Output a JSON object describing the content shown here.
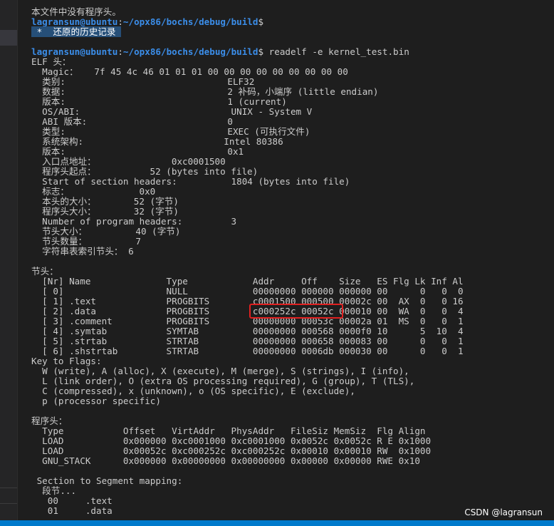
{
  "terminal": {
    "prior_output": "本文件中没有程序头。",
    "prompt1": {
      "user": "lagransun@ubuntu",
      "sep": ":",
      "path": "~/opx86/bochs/debug/build",
      "dollar": "$"
    },
    "history_marker": {
      "star": " * ",
      "text": " 还原的历史记录 "
    },
    "prompt2": {
      "user": "lagransun@ubuntu",
      "sep": ":",
      "path": "~/opx86/bochs/debug/build",
      "dollar": "$",
      "command": " readelf -e kernel_test.bin"
    },
    "elf_header": [
      "ELF 头：",
      "  Magic：   7f 45 4c 46 01 01 01 00 00 00 00 00 00 00 00 00",
      "  类别:                              ELF32",
      "  数据:                              2 补码，小端序 (little endian)",
      "  版本:                              1 (current)",
      "  OS/ABI:                            UNIX - System V",
      "  ABI 版本:                          0",
      "  类型:                              EXEC (可执行文件)",
      "  系统架构:                          Intel 80386",
      "  版本:                              0x1",
      "  入口点地址：              0xc0001500",
      "  程序头起点：          52 (bytes into file)",
      "  Start of section headers:          1804 (bytes into file)",
      "  标志：             0x0",
      "  本头的大小：       52 (字节)",
      "  程序头大小：       32 (字节)",
      "  Number of program headers:         3",
      "  节头大小：         40 (字节)",
      "  节头数量：         7",
      "  字符串表索引节头： 6"
    ],
    "section_headers_title": "节头：",
    "section_rows": [
      "  [Nr] Name              Type            Addr     Off    Size   ES Flg Lk Inf Al",
      "  [ 0]                   NULL            00000000 000000 000000 00      0   0  0",
      "  [ 1] .text             PROGBITS        c0001500 000500 00002c 00  AX  0   0 16",
      "  [ 2] .data             PROGBITS        c000252c 00052c 000010 00  WA  0   0  4",
      "  [ 3] .comment          PROGBITS        00000000 00053c 00002a 01  MS  0   0  1",
      "  [ 4] .symtab           SYMTAB          00000000 000568 0000f0 10      5  10  4",
      "  [ 5] .strtab           STRTAB          00000000 000658 000083 00      0   0  1",
      "  [ 6] .shstrtab         STRTAB          00000000 0006db 000030 00      0   0  1"
    ],
    "key_to_flags": [
      "Key to Flags:",
      "  W (write), A (alloc), X (execute), M (merge), S (strings), I (info),",
      "  L (link order), O (extra OS processing required), G (group), T (TLS),",
      "  C (compressed), x (unknown), o (OS specific), E (exclude),",
      "  p (processor specific)"
    ],
    "program_headers_title": "程序头：",
    "program_rows": [
      "  Type           Offset   VirtAddr   PhysAddr   FileSiz MemSiz  Flg Align",
      "  LOAD           0x000000 0xc0001000 0xc0001000 0x0052c 0x0052c R E 0x1000",
      "  LOAD           0x00052c 0xc000252c 0xc000252c 0x00010 0x00010 RW  0x1000",
      "  GNU_STACK      0x000000 0x00000000 0x00000000 0x00000 0x00000 RWE 0x10"
    ],
    "segment_mapping": [
      " Section to Segment mapping:",
      "  段节...",
      "   00     .text",
      "   01     .data"
    ]
  },
  "watermark": "CSDN @lagransun",
  "colors": {
    "background": "#1e1e1e",
    "prompt": "#3b8eea",
    "highlight": "#264f78",
    "annotation": "#e02020",
    "status_bar": "#007acc"
  }
}
